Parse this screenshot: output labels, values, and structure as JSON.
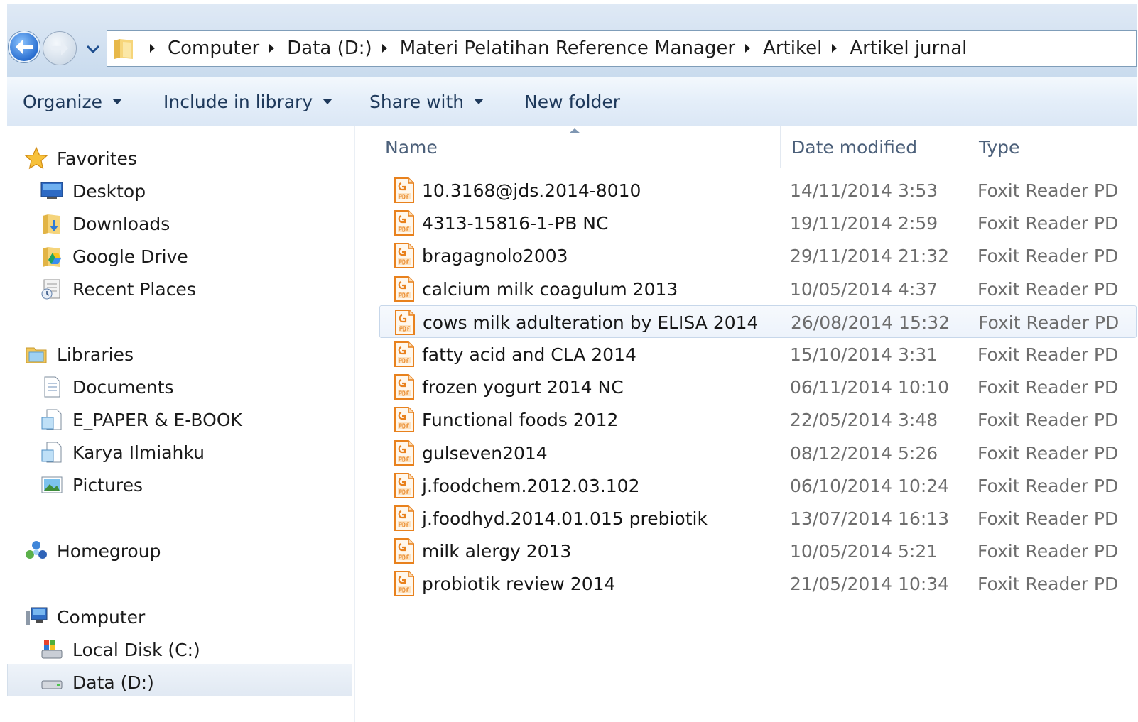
{
  "address": {
    "breadcrumbs": [
      "Computer",
      "Data (D:)",
      "Materi Pelatihan Reference Manager",
      "Artikel",
      "Artikel jurnal"
    ]
  },
  "toolbar": {
    "organize": "Organize",
    "include": "Include in library",
    "share": "Share with",
    "new_folder": "New folder"
  },
  "nav": {
    "favorites": {
      "label": "Favorites",
      "items": [
        "Desktop",
        "Downloads",
        "Google Drive",
        "Recent Places"
      ]
    },
    "libraries": {
      "label": "Libraries",
      "items": [
        "Documents",
        "E_PAPER & E-BOOK",
        "Karya Ilmiahku",
        "Pictures"
      ]
    },
    "homegroup": {
      "label": "Homegroup"
    },
    "computer": {
      "label": "Computer",
      "items": [
        "Local Disk (C:)",
        "Data (D:)"
      ],
      "selected": "Data (D:)"
    }
  },
  "columns": {
    "name": "Name",
    "date": "Date modified",
    "type": "Type"
  },
  "files": [
    {
      "name": "10.3168@jds.2014-8010",
      "date": "14/11/2014 3:53",
      "type": "Foxit Reader PD"
    },
    {
      "name": "4313-15816-1-PB NC",
      "date": "19/11/2014 2:59",
      "type": "Foxit Reader PD"
    },
    {
      "name": "bragagnolo2003",
      "date": "29/11/2014 21:32",
      "type": "Foxit Reader PD"
    },
    {
      "name": "calcium milk coagulum 2013",
      "date": "10/05/2014 4:37",
      "type": "Foxit Reader PD"
    },
    {
      "name": "cows milk adulteration by ELISA 2014",
      "date": "26/08/2014 15:32",
      "type": "Foxit Reader PD"
    },
    {
      "name": "fatty acid and CLA 2014",
      "date": "15/10/2014 3:31",
      "type": "Foxit Reader PD"
    },
    {
      "name": "frozen yogurt 2014 NC",
      "date": "06/11/2014 10:10",
      "type": "Foxit Reader PD"
    },
    {
      "name": "Functional foods 2012",
      "date": "22/05/2014 3:48",
      "type": "Foxit Reader PD"
    },
    {
      "name": "gulseven2014",
      "date": "08/12/2014 5:26",
      "type": "Foxit Reader PD"
    },
    {
      "name": "j.foodchem.2012.03.102",
      "date": "06/10/2014 10:24",
      "type": "Foxit Reader PD"
    },
    {
      "name": "j.foodhyd.2014.01.015 prebiotik",
      "date": "13/07/2014 16:13",
      "type": "Foxit Reader PD"
    },
    {
      "name": "milk alergy 2013",
      "date": "10/05/2014 5:21",
      "type": "Foxit Reader PD"
    },
    {
      "name": "probiotik review 2014",
      "date": "21/05/2014 10:34",
      "type": "Foxit Reader PD"
    }
  ],
  "selected_file": "cows milk adulteration by ELISA 2014"
}
